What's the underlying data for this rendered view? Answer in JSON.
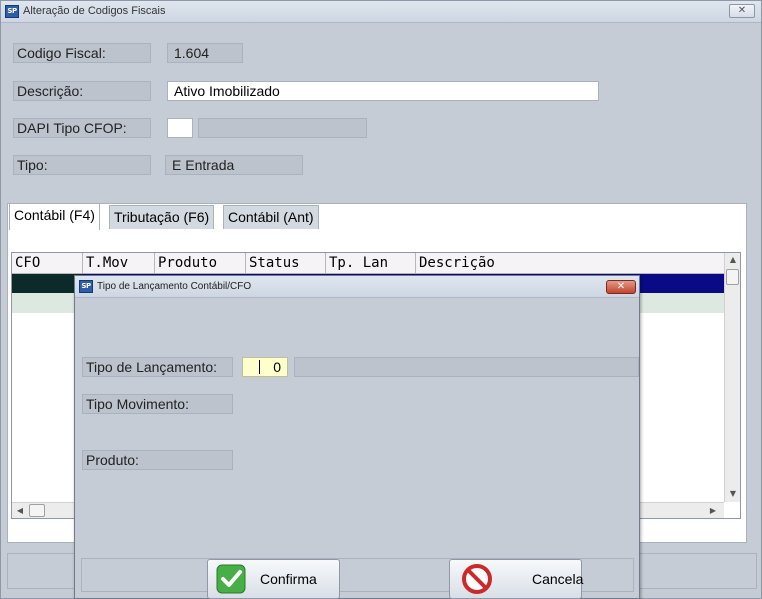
{
  "main_window": {
    "title": "Alteração de Codigos Fiscais",
    "icon": "app-logo-icon",
    "close": "close-icon"
  },
  "fields": {
    "codigo_fiscal_label": "Codigo Fiscal:",
    "codigo_fiscal_value": "1.604",
    "descricao_label": "Descrição:",
    "descricao_value": "Ativo Imobilizado",
    "dapi_label": "DAPI Tipo CFOP:",
    "dapi_code": "",
    "dapi_desc": "",
    "tipo_label": "Tipo:",
    "tipo_value": "E Entrada"
  },
  "tabs": [
    {
      "label": "Contábil (F4)",
      "active": true
    },
    {
      "label": "Tributação (F6)",
      "active": false
    },
    {
      "label": "Contábil (Ant)",
      "active": false
    }
  ],
  "grid": {
    "columns": [
      "CFO",
      "T.Mov",
      "Produto",
      "Status",
      "Tp. Lan",
      "Descrição"
    ],
    "selected_row_color": "#0a0a86",
    "alt_row_color": "#dde8e0"
  },
  "dialog": {
    "title": "Tipo de Lançamento Contábil/CFO",
    "tipo_lancamento_label": "Tipo de Lançamento:",
    "tipo_lancamento_value": "0",
    "tipo_lancamento_desc": "",
    "tipo_movimento_label": "Tipo Movimento:",
    "produto_label": "Produto:",
    "confirm_button": "Confirma",
    "confirm_icon": "checkmark-icon",
    "cancel_button": "Cancela",
    "cancel_icon": "no-entry-icon",
    "close_icon": "close-icon"
  },
  "colors": {
    "window_bg": "#c6ccd6",
    "input_highlight": "#ffffcc",
    "close_button": "#c0452e"
  }
}
